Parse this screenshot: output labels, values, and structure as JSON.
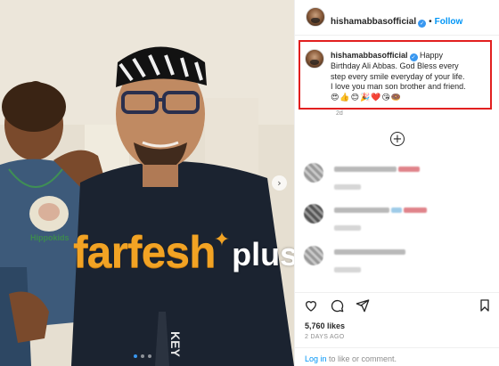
{
  "post": {
    "username": "hishamabbasofficial",
    "follow_label": "Follow",
    "separator": "•",
    "verified_glyph": "✓",
    "caption": {
      "username": "hishamabbasofficial",
      "text_1": " Happy",
      "text_2": "Birthday Ali Abbas. God Bless every",
      "text_3": "step every smile everyday of your life.",
      "text_4": "I love you man son brother and friend.",
      "emojis": "😍👍😊🎉❤️😘🍩"
    },
    "caption_time": "2d",
    "load_more_glyph": "+",
    "likes": "5,760 likes",
    "posted": "2 DAYS AGO",
    "login": {
      "link": "Log in",
      "rest": " to like or comment."
    }
  },
  "photo": {
    "watermark_main": "farfesh",
    "watermark_sub": "plus.com",
    "watermark_star": "✦",
    "shirt_text": "KEY",
    "badge_text": "Hippokids",
    "next_glyph": "›",
    "carousel": {
      "count": 3,
      "active": 1
    }
  },
  "icons": {
    "like": "heart-icon",
    "comment": "comment-icon",
    "share": "share-icon",
    "save": "bookmark-icon"
  },
  "colors": {
    "accent": "#0095f6",
    "highlight_border": "#e21f1f",
    "watermark": "#f2a324"
  }
}
